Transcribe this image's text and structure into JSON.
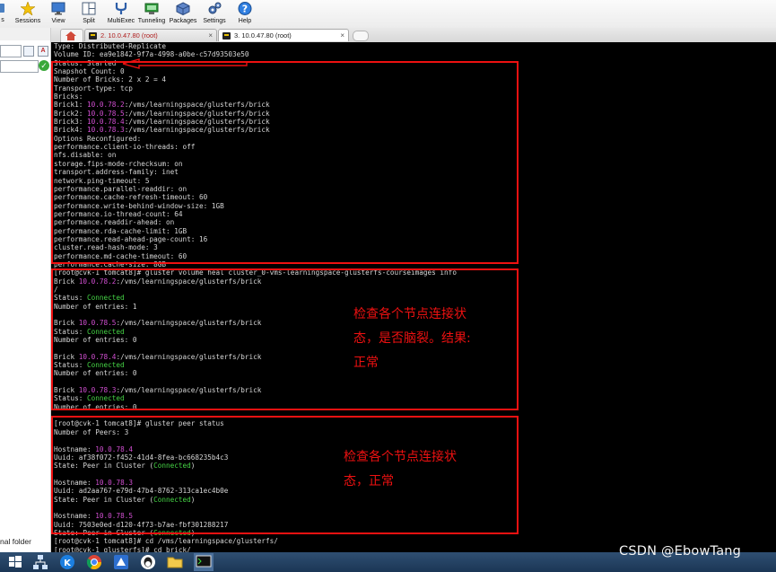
{
  "toolbar": {
    "items": [
      {
        "label": "s",
        "icon": "partial-icon"
      },
      {
        "label": "Sessions",
        "icon": "star-icon"
      },
      {
        "label": "View",
        "icon": "monitor-icon"
      },
      {
        "label": "Split",
        "icon": "split-icon"
      },
      {
        "label": "MultiExec",
        "icon": "fork-icon"
      },
      {
        "label": "Tunneling",
        "icon": "tunnel-icon"
      },
      {
        "label": "Packages",
        "icon": "package-icon"
      },
      {
        "label": "Settings",
        "icon": "gear-icon"
      },
      {
        "label": "Help",
        "icon": "help-icon"
      }
    ]
  },
  "left_panel": {
    "icon_a": "A",
    "folder_label": "nal folder"
  },
  "tabs": [
    {
      "label": "2. 10.0.47.80 (root)",
      "active": false
    },
    {
      "label": "3. 10.0.47.80 (root)",
      "active": true
    }
  ],
  "terminal": {
    "colors": {
      "ip": "#d24fd2",
      "ok": "#45d445",
      "highlight": "#ee1111"
    },
    "lines": [
      [
        {
          "t": "Type: Distributed-Replicate"
        }
      ],
      [
        {
          "t": "Volume ID: ea9e1842-9f7a-4998-a0be-c57d93503e50"
        }
      ],
      [
        {
          "t": "Status: Started"
        }
      ],
      [
        {
          "t": "Snapshot Count: 0"
        }
      ],
      [
        {
          "t": "Number of Bricks: 2 x 2 = 4"
        }
      ],
      [
        {
          "t": "Transport-type: tcp"
        }
      ],
      [
        {
          "t": "Bricks:"
        }
      ],
      [
        {
          "t": "Brick1: "
        },
        {
          "t": "10.0.78.2",
          "c": "ip"
        },
        {
          "t": ":/vms/learningspace/glusterfs/brick"
        }
      ],
      [
        {
          "t": "Brick2: "
        },
        {
          "t": "10.0.78.5",
          "c": "ip"
        },
        {
          "t": ":/vms/learningspace/glusterfs/brick"
        }
      ],
      [
        {
          "t": "Brick3: "
        },
        {
          "t": "10.0.78.4",
          "c": "ip"
        },
        {
          "t": ":/vms/learningspace/glusterfs/brick"
        }
      ],
      [
        {
          "t": "Brick4: "
        },
        {
          "t": "10.0.78.3",
          "c": "ip"
        },
        {
          "t": ":/vms/learningspace/glusterfs/brick"
        }
      ],
      [
        {
          "t": "Options Reconfigured:"
        }
      ],
      [
        {
          "t": "performance.client-io-threads: off"
        }
      ],
      [
        {
          "t": "nfs.disable: on"
        }
      ],
      [
        {
          "t": "storage.fips-mode-rchecksum: on"
        }
      ],
      [
        {
          "t": "transport.address-family: inet"
        }
      ],
      [
        {
          "t": "network.ping-timeout: 5"
        }
      ],
      [
        {
          "t": "performance.parallel-readdir: on"
        }
      ],
      [
        {
          "t": "performance.cache-refresh-timeout: 60"
        }
      ],
      [
        {
          "t": "performance.write-behind-window-size: 1GB"
        }
      ],
      [
        {
          "t": "performance.io-thread-count: 64"
        }
      ],
      [
        {
          "t": "performance.readdir-ahead: on"
        }
      ],
      [
        {
          "t": "performance.rda-cache-limit: 1GB"
        }
      ],
      [
        {
          "t": "performance.read-ahead-page-count: 16"
        }
      ],
      [
        {
          "t": "cluster.read-hash-mode: 3"
        }
      ],
      [
        {
          "t": "performance.md-cache-timeout: 60"
        }
      ],
      [
        {
          "t": "performance.cache-size: 8GB"
        }
      ],
      [
        {
          "t": "[root@cvk-1 tomcat8]# gluster volume heal cluster_0-vms-learningspace-glusterfs-courseimages info"
        }
      ],
      [
        {
          "t": "Brick "
        },
        {
          "t": "10.0.78.2",
          "c": "ip"
        },
        {
          "t": ":/vms/learningspace/glusterfs/brick"
        }
      ],
      [
        {
          "t": "/"
        }
      ],
      [
        {
          "t": "Status: "
        },
        {
          "t": "Connected",
          "c": "ok"
        }
      ],
      [
        {
          "t": "Number of entries: 1"
        }
      ],
      [
        {
          "t": ""
        }
      ],
      [
        {
          "t": "Brick "
        },
        {
          "t": "10.0.78.5",
          "c": "ip"
        },
        {
          "t": ":/vms/learningspace/glusterfs/brick"
        }
      ],
      [
        {
          "t": "Status: "
        },
        {
          "t": "Connected",
          "c": "ok"
        }
      ],
      [
        {
          "t": "Number of entries: 0"
        }
      ],
      [
        {
          "t": ""
        }
      ],
      [
        {
          "t": "Brick "
        },
        {
          "t": "10.0.78.4",
          "c": "ip"
        },
        {
          "t": ":/vms/learningspace/glusterfs/brick"
        }
      ],
      [
        {
          "t": "Status: "
        },
        {
          "t": "Connected",
          "c": "ok"
        }
      ],
      [
        {
          "t": "Number of entries: 0"
        }
      ],
      [
        {
          "t": ""
        }
      ],
      [
        {
          "t": "Brick "
        },
        {
          "t": "10.0.78.3",
          "c": "ip"
        },
        {
          "t": ":/vms/learningspace/glusterfs/brick"
        }
      ],
      [
        {
          "t": "Status: "
        },
        {
          "t": "Connected",
          "c": "ok"
        }
      ],
      [
        {
          "t": "Number of entries: 0"
        }
      ],
      [
        {
          "t": ""
        }
      ],
      [
        {
          "t": "[root@cvk-1 tomcat8]# gluster peer status"
        }
      ],
      [
        {
          "t": "Number of Peers: 3"
        }
      ],
      [
        {
          "t": ""
        }
      ],
      [
        {
          "t": "Hostname: "
        },
        {
          "t": "10.0.78.4",
          "c": "ip"
        }
      ],
      [
        {
          "t": "Uuid: af38f072-f452-41d4-8fea-bc668235b4c3"
        }
      ],
      [
        {
          "t": "State: Peer in Cluster ("
        },
        {
          "t": "Connected",
          "c": "ok"
        },
        {
          "t": ")"
        }
      ],
      [
        {
          "t": ""
        }
      ],
      [
        {
          "t": "Hostname: "
        },
        {
          "t": "10.0.78.3",
          "c": "ip"
        }
      ],
      [
        {
          "t": "Uuid: ad2aa767-e79d-47b4-8762-313ca1ec4b0e"
        }
      ],
      [
        {
          "t": "State: Peer in Cluster ("
        },
        {
          "t": "Connected",
          "c": "ok"
        },
        {
          "t": ")"
        }
      ],
      [
        {
          "t": ""
        }
      ],
      [
        {
          "t": "Hostname: "
        },
        {
          "t": "10.0.78.5",
          "c": "ip"
        }
      ],
      [
        {
          "t": "Uuid: 7503e0ed-d120-4f73-b7ae-fbf301288217"
        }
      ],
      [
        {
          "t": "State: Peer in Cluster ("
        },
        {
          "t": "Connected",
          "c": "ok"
        },
        {
          "t": ")"
        }
      ],
      [
        {
          "t": "[root@cvk-1 tomcat8]# cd /vms/learningspace/glusterfs/"
        }
      ],
      [
        {
          "t": "[root@cvk-1 glusterfs]# cd brick/"
        }
      ]
    ]
  },
  "annotations": {
    "heal_check": "检查各个节点连接状\n态，是否脑裂。结果:\n正常",
    "peer_check": "检查各个节点连接状\n态，正常"
  },
  "taskbar": {
    "icons": [
      "start-icon",
      "network-icon",
      "k-app-icon",
      "chrome-icon",
      "mobaxterm-icon",
      "qq-icon",
      "folder-icon",
      "terminal-icon"
    ]
  },
  "watermark": "CSDN @EbowTang"
}
